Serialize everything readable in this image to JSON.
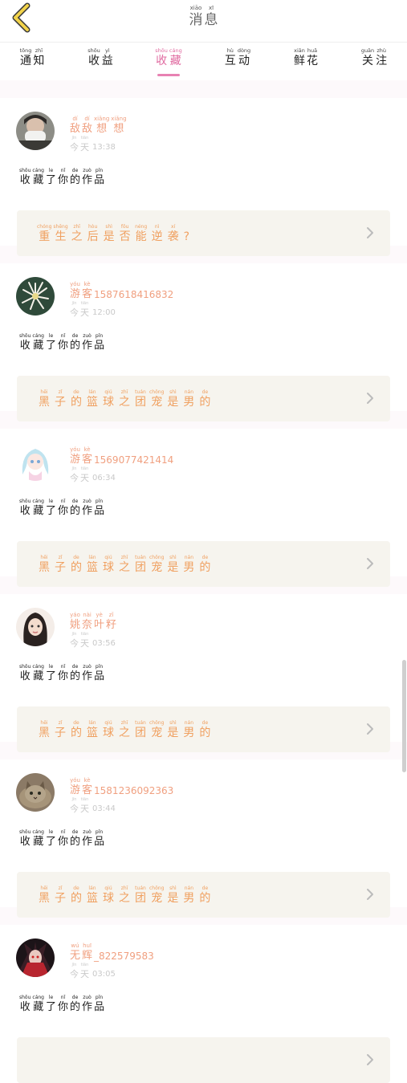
{
  "header": {
    "title": [
      {
        "h": "消",
        "p": "xiāo"
      },
      {
        "h": "息",
        "p": "xī"
      }
    ],
    "colors": {
      "back_icon": "#f2d34a"
    }
  },
  "tabs": [
    {
      "chars": [
        {
          "h": "通",
          "p": "tōng"
        },
        {
          "h": "知",
          "p": "zhī"
        }
      ],
      "active": false
    },
    {
      "chars": [
        {
          "h": "收",
          "p": "shōu"
        },
        {
          "h": "益",
          "p": "yì"
        }
      ],
      "active": false
    },
    {
      "chars": [
        {
          "h": "收",
          "p": "shōu"
        },
        {
          "h": "藏",
          "p": "cáng"
        }
      ],
      "active": true
    },
    {
      "chars": [
        {
          "h": "互",
          "p": "hù"
        },
        {
          "h": "动",
          "p": "dòng"
        }
      ],
      "active": false
    },
    {
      "chars": [
        {
          "h": "鲜",
          "p": "xiān"
        },
        {
          "h": "花",
          "p": "huā"
        }
      ],
      "active": false
    },
    {
      "chars": [
        {
          "h": "关",
          "p": "guān"
        },
        {
          "h": "注",
          "p": "zhù"
        }
      ],
      "active": false
    }
  ],
  "action_text": [
    {
      "h": "收",
      "p": "shōu"
    },
    {
      "h": "藏",
      "p": "cáng"
    },
    {
      "h": "了",
      "p": "le"
    },
    {
      "h": "你",
      "p": "nǐ"
    },
    {
      "h": "的",
      "p": "de"
    },
    {
      "h": "作",
      "p": "zuò"
    },
    {
      "h": "品",
      "p": "pǐn"
    }
  ],
  "time_prefix": [
    {
      "h": "今",
      "p": "jīn"
    },
    {
      "h": "天",
      "p": "tiān"
    }
  ],
  "items": [
    {
      "avatar": "avatar-person-mask",
      "name_chars": [
        {
          "h": "敌",
          "p": "dí"
        },
        {
          "h": "敌",
          "p": "dí"
        },
        {
          "h": "想",
          "p": "xiǎng"
        },
        {
          "h": "想",
          "p": "xiǎng"
        }
      ],
      "name_suffix": "",
      "time": "13:38",
      "work_chars": [
        {
          "h": "重",
          "p": "chóng"
        },
        {
          "h": "生",
          "p": "shēng"
        },
        {
          "h": "之",
          "p": "zhī"
        },
        {
          "h": "后",
          "p": "hòu"
        },
        {
          "h": "是",
          "p": "shì"
        },
        {
          "h": "否",
          "p": "fǒu"
        },
        {
          "h": "能",
          "p": "néng"
        },
        {
          "h": "逆",
          "p": "nì"
        },
        {
          "h": "袭",
          "p": "xí"
        }
      ],
      "work_suffix": "?"
    },
    {
      "avatar": "avatar-white-flower",
      "name_chars": [
        {
          "h": "游",
          "p": "yóu"
        },
        {
          "h": "客",
          "p": "kè"
        }
      ],
      "name_suffix": "15876184​16832",
      "time": "12:00",
      "work_chars": [
        {
          "h": "黑",
          "p": "hēi"
        },
        {
          "h": "子",
          "p": "zǐ"
        },
        {
          "h": "的",
          "p": "de"
        },
        {
          "h": "篮",
          "p": "lán"
        },
        {
          "h": "球",
          "p": "qiú"
        },
        {
          "h": "之",
          "p": "zhī"
        },
        {
          "h": "团",
          "p": "tuán"
        },
        {
          "h": "宠",
          "p": "chǒng"
        },
        {
          "h": "是",
          "p": "shì"
        },
        {
          "h": "男",
          "p": "nán"
        },
        {
          "h": "的",
          "p": "de"
        }
      ],
      "work_suffix": ""
    },
    {
      "avatar": "avatar-anime-girl",
      "name_chars": [
        {
          "h": "游",
          "p": "yóu"
        },
        {
          "h": "客",
          "p": "kè"
        }
      ],
      "name_suffix": "15690774​21414",
      "time": "06:34",
      "work_chars": [
        {
          "h": "黑",
          "p": "hēi"
        },
        {
          "h": "子",
          "p": "zǐ"
        },
        {
          "h": "的",
          "p": "de"
        },
        {
          "h": "篮",
          "p": "lán"
        },
        {
          "h": "球",
          "p": "qiú"
        },
        {
          "h": "之",
          "p": "zhī"
        },
        {
          "h": "团",
          "p": "tuán"
        },
        {
          "h": "宠",
          "p": "chǒng"
        },
        {
          "h": "是",
          "p": "shì"
        },
        {
          "h": "男",
          "p": "nán"
        },
        {
          "h": "的",
          "p": "de"
        }
      ],
      "work_suffix": ""
    },
    {
      "avatar": "avatar-girl-dark-hair",
      "name_chars": [
        {
          "h": "姚",
          "p": "yáo"
        },
        {
          "h": "奈",
          "p": "nài"
        },
        {
          "h": "叶",
          "p": "yè"
        },
        {
          "h": "籽",
          "p": "zǐ"
        }
      ],
      "name_suffix": "",
      "time": "03:56",
      "work_chars": [
        {
          "h": "黑",
          "p": "hēi"
        },
        {
          "h": "子",
          "p": "zǐ"
        },
        {
          "h": "的",
          "p": "de"
        },
        {
          "h": "篮",
          "p": "lán"
        },
        {
          "h": "球",
          "p": "qiú"
        },
        {
          "h": "之",
          "p": "zhī"
        },
        {
          "h": "团",
          "p": "tuán"
        },
        {
          "h": "宠",
          "p": "chǒng"
        },
        {
          "h": "是",
          "p": "shì"
        },
        {
          "h": "男",
          "p": "nán"
        },
        {
          "h": "的",
          "p": "de"
        }
      ],
      "work_suffix": ""
    },
    {
      "avatar": "avatar-cat",
      "name_chars": [
        {
          "h": "游",
          "p": "yóu"
        },
        {
          "h": "客",
          "p": "kè"
        }
      ],
      "name_suffix": "15812360​92363",
      "time": "03:44",
      "work_chars": [
        {
          "h": "黑",
          "p": "hēi"
        },
        {
          "h": "子",
          "p": "zǐ"
        },
        {
          "h": "的",
          "p": "de"
        },
        {
          "h": "篮",
          "p": "lán"
        },
        {
          "h": "球",
          "p": "qiú"
        },
        {
          "h": "之",
          "p": "zhī"
        },
        {
          "h": "团",
          "p": "tuán"
        },
        {
          "h": "宠",
          "p": "chǒng"
        },
        {
          "h": "是",
          "p": "shì"
        },
        {
          "h": "男",
          "p": "nán"
        },
        {
          "h": "的",
          "p": "de"
        }
      ],
      "work_suffix": ""
    },
    {
      "avatar": "avatar-dark-character",
      "name_chars": [
        {
          "h": "无",
          "p": "wú"
        },
        {
          "h": "辉",
          "p": "huī"
        }
      ],
      "name_suffix": "_822579583",
      "time": "03:05",
      "work_chars": [],
      "work_suffix": ""
    }
  ]
}
